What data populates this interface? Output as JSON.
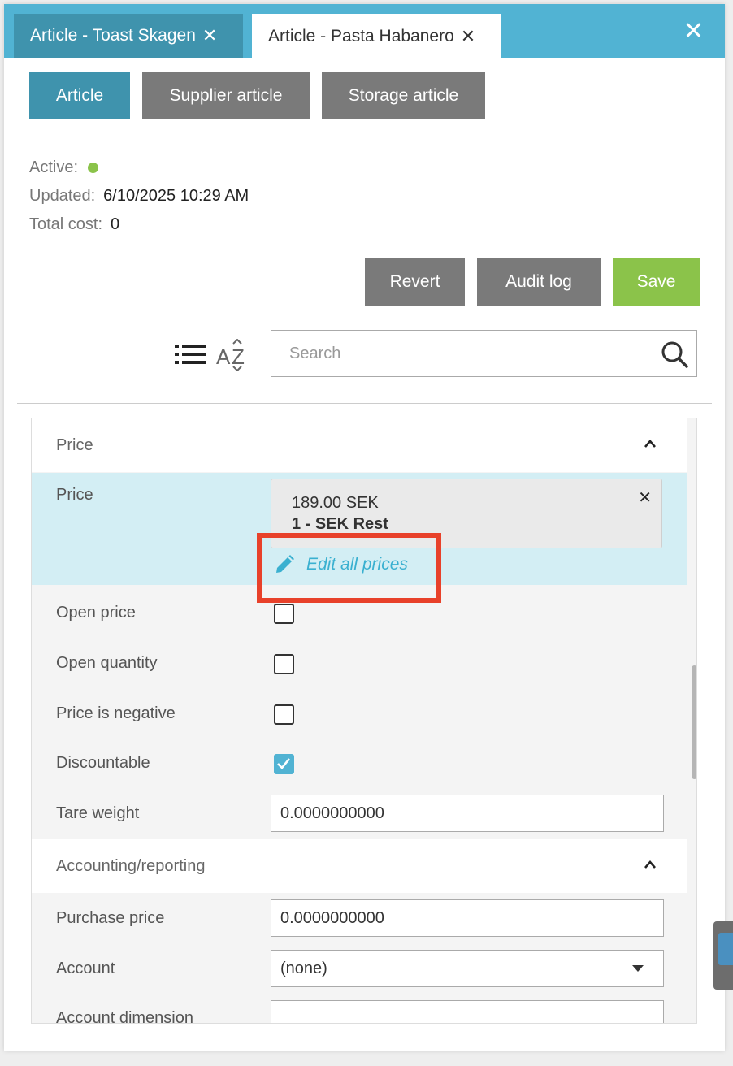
{
  "tabs": [
    {
      "label": "Article - Toast Skagen",
      "close": "✕",
      "active": false
    },
    {
      "label": "Article - Pasta Habanero",
      "close": "✕",
      "active": true
    }
  ],
  "window_close": "✕",
  "subtabs": {
    "article": "Article",
    "supplier": "Supplier article",
    "storage": "Storage article"
  },
  "info": {
    "active_label": "Active:",
    "active_status_color": "#8bc34a",
    "updated_label": "Updated:",
    "updated_value": "6/10/2025 10:29 AM",
    "total_cost_label": "Total cost:",
    "total_cost_value": "0"
  },
  "actions": {
    "revert": "Revert",
    "audit_log": "Audit log",
    "save": "Save"
  },
  "toolbar": {
    "list_view_icon": "list-icon",
    "sort_icon": "sort-az-icon",
    "search_placeholder": "Search",
    "search_icon": "search-icon"
  },
  "price_section": {
    "header": "Price",
    "price_label": "Price",
    "price_value": "189.00 SEK",
    "price_list": "1 - SEK Rest",
    "remove": "✕",
    "edit_all_prices": "Edit all prices",
    "fields": {
      "open_price": {
        "label": "Open price",
        "checked": false
      },
      "open_quantity": {
        "label": "Open quantity",
        "checked": false
      },
      "price_negative": {
        "label": "Price is negative",
        "checked": false
      },
      "discountable": {
        "label": "Discountable",
        "checked": true
      },
      "tare_weight": {
        "label": "Tare weight",
        "value": "0.0000000000"
      }
    }
  },
  "accounting_section": {
    "header": "Accounting/reporting",
    "purchase_price": {
      "label": "Purchase price",
      "value": "0.0000000000"
    },
    "account": {
      "label": "Account",
      "value": "(none)"
    },
    "account_dimension": {
      "label": "Account dimension",
      "value": ""
    }
  },
  "colors": {
    "accent": "#51b3d3",
    "accent_dark": "#3f93ad",
    "save_green": "#8bc34a",
    "highlight": "#e8412a"
  }
}
